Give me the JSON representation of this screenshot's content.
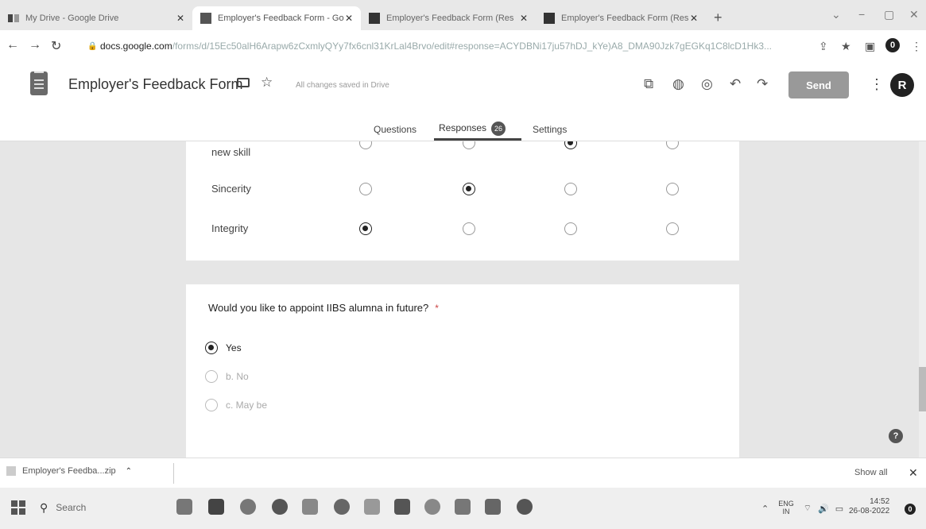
{
  "browser": {
    "tabs": [
      {
        "label": "My Drive - Google Drive",
        "icon": "drive-icon",
        "active": false
      },
      {
        "label": "Employer's Feedback Form - Go",
        "icon": "forms-icon",
        "active": true
      },
      {
        "label": "Employer's Feedback Form (Res",
        "icon": "sheets-icon",
        "active": false
      },
      {
        "label": "Employer's Feedback Form (Res",
        "icon": "sheets-icon",
        "active": false
      }
    ],
    "url_host": "docs.google.com",
    "url_path": "/forms/d/15Ec50alH6Arapw6zCxmlyQYy7fx6cnl31KrLal4Brvo/edit#response=ACYDBNi17ju57hDJ_kYe)A8_DMA90Jzk7gEGKq1C8lcD1Hk3...",
    "profile_initial": "0"
  },
  "form_header": {
    "title": "Employer's Feedback Form",
    "save_status": "All changes saved in Drive",
    "send_label": "Send",
    "avatar_initial": "R",
    "tabs": {
      "questions": "Questions",
      "responses": "Responses",
      "responses_count": "26",
      "settings": "Settings"
    }
  },
  "grid_question": {
    "rows": [
      {
        "label": "new skill",
        "selected_column": 3
      },
      {
        "label": "Sincerity",
        "selected_column": 2
      },
      {
        "label": "Integrity",
        "selected_column": 1
      }
    ],
    "column_count": 4
  },
  "choice_question": {
    "text": "Would you like to appoint  IIBS alumna  in future?",
    "required_marker": "*",
    "options": [
      {
        "label": "Yes",
        "selected": true
      },
      {
        "label": "b. No",
        "selected": false
      },
      {
        "label": "c. May be",
        "selected": false
      }
    ]
  },
  "downloads": {
    "item": "Employer's Feedba...zip",
    "show_all": "Show all"
  },
  "taskbar": {
    "search_placeholder": "Search",
    "lang_top": "ENG",
    "lang_bottom": "IN",
    "time": "14:52",
    "date": "26-08-2022",
    "notification_count": "0"
  }
}
